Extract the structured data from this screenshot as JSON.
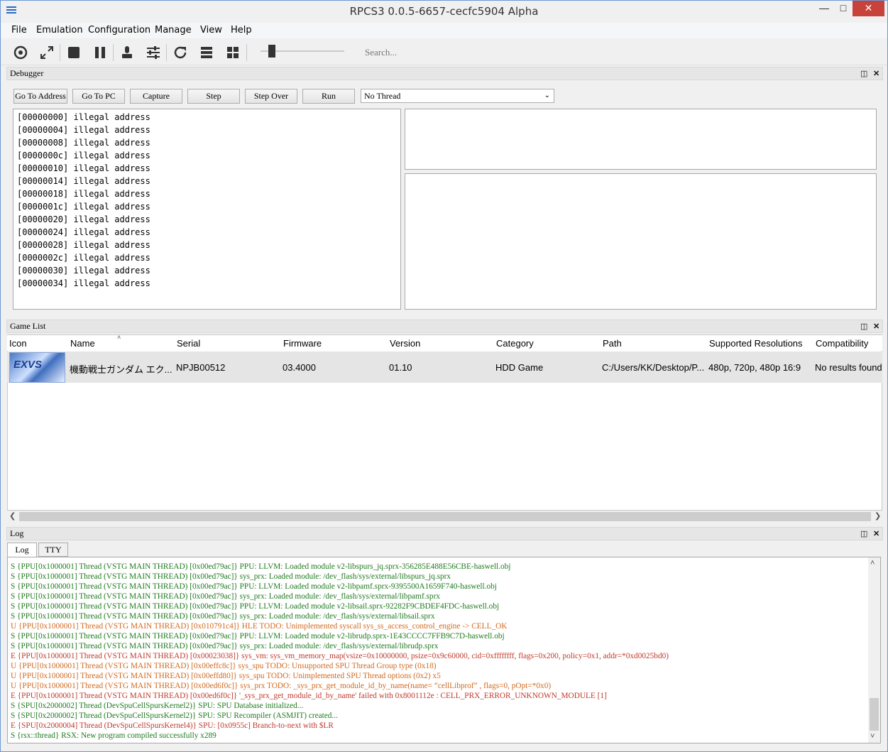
{
  "window": {
    "title": "RPCS3 0.0.5-6657-cecfc5904 Alpha"
  },
  "menu": [
    "File",
    "Emulation",
    "Configuration",
    "Manage",
    "View",
    "Help"
  ],
  "toolbar": {
    "icons": [
      "open-icon",
      "fullscreen-icon",
      "stop-icon",
      "pause-icon",
      "pads-icon",
      "settings-icon",
      "refresh-icon",
      "list-view-icon",
      "grid-view-icon"
    ],
    "search_placeholder": "Search..."
  },
  "debugger": {
    "title": "Debugger",
    "buttons": [
      "Go To Address",
      "Go To PC",
      "Capture",
      "Step",
      "Step Over",
      "Run"
    ],
    "thread_select": "No Thread",
    "memory_lines": [
      "[00000000] illegal address",
      "[00000004] illegal address",
      "[00000008] illegal address",
      "[0000000c] illegal address",
      "[00000010] illegal address",
      "[00000014] illegal address",
      "[00000018] illegal address",
      "[0000001c] illegal address",
      "[00000020] illegal address",
      "[00000024] illegal address",
      "[00000028] illegal address",
      "[0000002c] illegal address",
      "[00000030] illegal address",
      "[00000034] illegal address"
    ]
  },
  "game_list": {
    "title": "Game List",
    "columns": [
      "Icon",
      "Name",
      "Serial",
      "Firmware",
      "Version",
      "Category",
      "Path",
      "Supported Resolutions",
      "Compatibility"
    ],
    "rows": [
      {
        "icon_text": "EXVS",
        "name": "機動戦士ガンダム エク...",
        "serial": "NPJB00512",
        "firmware": "03.4000",
        "version": "01.10",
        "category": "HDD Game",
        "path": "C:/Users/KK/Desktop/P...",
        "resolutions": "480p, 720p, 480p 16:9",
        "compatibility": "No results found"
      }
    ]
  },
  "log": {
    "title": "Log",
    "tabs": [
      "Log",
      "TTY"
    ],
    "lines": [
      {
        "text": "S {PPU[0x1000001] Thread (VSTG MAIN THREAD) [0x00ed79ac]} PPU: LLVM: Loaded module v2-libspurs_jq.sprx-356285E488E56CBE-haswell.obj",
        "color": "#1e7a1e"
      },
      {
        "text": "S {PPU[0x1000001] Thread (VSTG MAIN THREAD) [0x00ed79ac]} sys_prx: Loaded module: /dev_flash/sys/external/libspurs_jq.sprx",
        "color": "#1e7a1e"
      },
      {
        "text": "S {PPU[0x1000001] Thread (VSTG MAIN THREAD) [0x00ed79ac]} PPU: LLVM: Loaded module v2-libpamf.sprx-9395500A1659F740-haswell.obj",
        "color": "#1e7a1e"
      },
      {
        "text": "S {PPU[0x1000001] Thread (VSTG MAIN THREAD) [0x00ed79ac]} sys_prx: Loaded module: /dev_flash/sys/external/libpamf.sprx",
        "color": "#1e7a1e"
      },
      {
        "text": "S {PPU[0x1000001] Thread (VSTG MAIN THREAD) [0x00ed79ac]} PPU: LLVM: Loaded module v2-libsail.sprx-92282F9CBDEF4FDC-haswell.obj",
        "color": "#1e7a1e"
      },
      {
        "text": "S {PPU[0x1000001] Thread (VSTG MAIN THREAD) [0x00ed79ac]} sys_prx: Loaded module: /dev_flash/sys/external/libsail.sprx",
        "color": "#1e7a1e"
      },
      {
        "text": "U {PPU[0x1000001] Thread (VSTG MAIN THREAD) [0x010791c4]} HLE TODO: Unimplemented syscall sys_ss_access_control_engine -> CELL_OK",
        "color": "#d2691e"
      },
      {
        "text": "S {PPU[0x1000001] Thread (VSTG MAIN THREAD) [0x00ed79ac]} PPU: LLVM: Loaded module v2-librudp.sprx-1E43CCCC7FFB9C7D-haswell.obj",
        "color": "#1e7a1e"
      },
      {
        "text": "S {PPU[0x1000001] Thread (VSTG MAIN THREAD) [0x00ed79ac]} sys_prx: Loaded module: /dev_flash/sys/external/librudp.sprx",
        "color": "#1e7a1e"
      },
      {
        "text": "E {PPU[0x1000001] Thread (VSTG MAIN THREAD) [0x00023038]} sys_vm: sys_vm_memory_map(vsize=0x10000000, psize=0x9c60000, cid=0xffffffff, flags=0x200, policy=0x1, addr=*0xd0025bd0)",
        "color": "#c0392b"
      },
      {
        "text": "U {PPU[0x1000001] Thread (VSTG MAIN THREAD) [0x00effc8c]} sys_spu TODO: Unsupported SPU Thread Group type (0x18)",
        "color": "#d2691e"
      },
      {
        "text": "U {PPU[0x1000001] Thread (VSTG MAIN THREAD) [0x00effd80]} sys_spu TODO: Unimplemented SPU Thread options (0x2) x5",
        "color": "#d2691e"
      },
      {
        "text": "U {PPU[0x1000001] Thread (VSTG MAIN THREAD) [0x00ed6f0c]} sys_prx TODO: _sys_prx_get_module_id_by_name(name= “cellLibprof” , flags=0, pOpt=*0x0)",
        "color": "#d2691e"
      },
      {
        "text": "E {PPU[0x1000001] Thread (VSTG MAIN THREAD) [0x00ed6f0c]} '_sys_prx_get_module_id_by_name' failed with 0x8001112e : CELL_PRX_ERROR_UNKNOWN_MODULE [1]",
        "color": "#c0392b"
      },
      {
        "text": "S {SPU[0x2000002] Thread (DevSpuCellSpursKernel2)} SPU: SPU Database initialized...",
        "color": "#1e7a1e"
      },
      {
        "text": "S {SPU[0x2000002] Thread (DevSpuCellSpursKernel2)} SPU: SPU Recompiler (ASMJIT) created...",
        "color": "#1e7a1e"
      },
      {
        "text": "E {SPU[0x2000004] Thread (DevSpuCellSpursKernel4)} SPU: [0x0955c] Branch-to-next with $LR",
        "color": "#c0392b"
      },
      {
        "text": "S {rsx::thread} RSX: New program compiled successfully x289",
        "color": "#1e7a1e"
      }
    ]
  }
}
